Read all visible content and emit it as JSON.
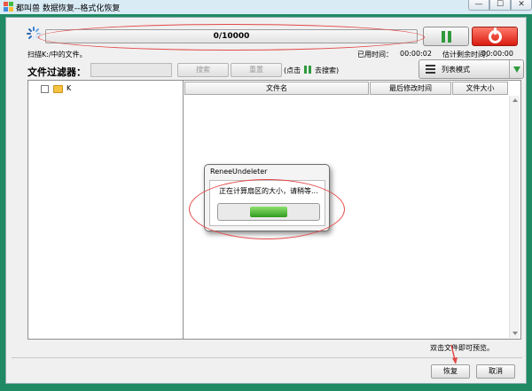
{
  "window": {
    "title": "都叫兽 数据恢复--格式化恢复",
    "buttons": {
      "minimize": "—",
      "maximize": "☐",
      "close": "✕"
    }
  },
  "progress": {
    "text": "0/10000",
    "scan_path": "扫描K:/中的文件。",
    "elapsed_label": "已用时间：",
    "elapsed_value": "00:00:02",
    "remaining_label": "估计剩余时间：",
    "remaining_value": "00:00:00"
  },
  "filter": {
    "label": "文件过滤器：",
    "input_value": "",
    "search_label": "搜索",
    "reset_label": "重置",
    "hint_prefix": "(点击",
    "hint_suffix": "去搜索)"
  },
  "view_mode": {
    "selected": "列表模式"
  },
  "tree": {
    "items": [
      {
        "label": "K"
      }
    ]
  },
  "file_list": {
    "columns": [
      "文件名",
      "最后修改时间",
      "文件大小"
    ],
    "rows": []
  },
  "dialog": {
    "title": "ReneeUndeleter",
    "message": "正在计算扇区的大小，请稍等...",
    "progress_fraction": 0.5
  },
  "footer": {
    "preview_hint": "双击文件即可预览。",
    "recover_label": "恢复",
    "cancel_label": "取消"
  },
  "colors": {
    "frame": "#1f8a63",
    "accent_green": "#2f9a3c",
    "stop_red": "#d91c10",
    "annotation_red": "#e34848",
    "folder": "#f5c243"
  }
}
